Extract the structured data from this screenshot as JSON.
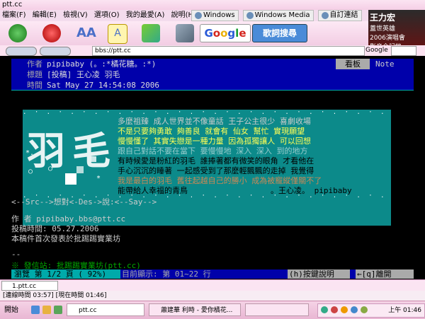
{
  "window": {
    "title": "ptt.cc"
  },
  "menu": [
    "檔案(F)",
    "編輯(E)",
    "檢視(V)",
    "選項(O)",
    "我的最愛(A)",
    "說明(H)"
  ],
  "links": [
    "Windows",
    "Windows Media",
    "自訂連結"
  ],
  "promo": {
    "name": "王力宏",
    "line1": "蓋世英雄",
    "line2": "2006演唱會",
    "line3": "影音全記錄"
  },
  "toolbar": {
    "google": "Google",
    "lyrics": "歌詞搜尋"
  },
  "address": {
    "value": "bbs://ptt.cc",
    "google_label": "Google"
  },
  "article": {
    "author_key": "作者",
    "author_val": "pipibaby (。:*橘花糖。:*)",
    "board_key": "看板",
    "board_val": "Note",
    "title_key": "標題",
    "title_val": "[投稿] 王心凌  羽毛",
    "time_key": "時間",
    "time_val": "Sat May 27 14:54:08 2006"
  },
  "signature": {
    "big": "羽毛",
    "lines": [
      "多麼祖臻  成人世界並不像童話 王子公主很少  喜劇收場",
      "不是只要夠勇敢  夠善良  就會有  仙女  幫忙  實現願望",
      "慢慢懂了  其實失戀是一種力量 因為孤獨讓人  可以回想",
      "跟自己對話不要在當下  要慢慢地  深入  深入  到的地方",
      "有時候愛是粉紅的羽毛  誰捧著都有微笑的眼角  才看他在",
      "手心沉沉的睡著  一起感受到了那麼輕飄飄的走掉  我覺得",
      "我是最白的羽毛  舊往起越自己的勝小  成為被寵縱僅關不了",
      "能帶給人幸福的青鳥",
      "。王心凌。 pipibaby"
    ]
  },
  "src_line": "<--Src-->想對<-Des->說:<--Say-->",
  "author_line": "作    者 pipibaby.bbs@ptt.cc",
  "posttime_line": "投稿時間: 05.27.2006",
  "notice_line": "本稿件首次發表於批踢踢實業坊",
  "dash_line": "--",
  "origin_line": "※ 發信站: 批踢踢實業坊(ptt.cc)",
  "status": {
    "page": "瀏覽 第 1/2 頁 ( 92%)",
    "range": "目前顯示: 第 01~22 行",
    "help": "(h)按鍵說明",
    "leave": "←[q]離開"
  },
  "tab": {
    "label": "1.ptt.cc"
  },
  "statusline": "[連線時間 03:57] [現在時間 01:46]",
  "taskbar": {
    "start": "開始",
    "tasks": [
      "ptt.cc",
      "蕭建華 利時 - 愛你橘花...",
      ""
    ],
    "clock": "上午 01:46"
  },
  "colors": {
    "terminal_bg": "#000000",
    "header_bg": "#0000aa",
    "signature_bg": "#0c8a8a",
    "yellow": "#ffff55"
  }
}
